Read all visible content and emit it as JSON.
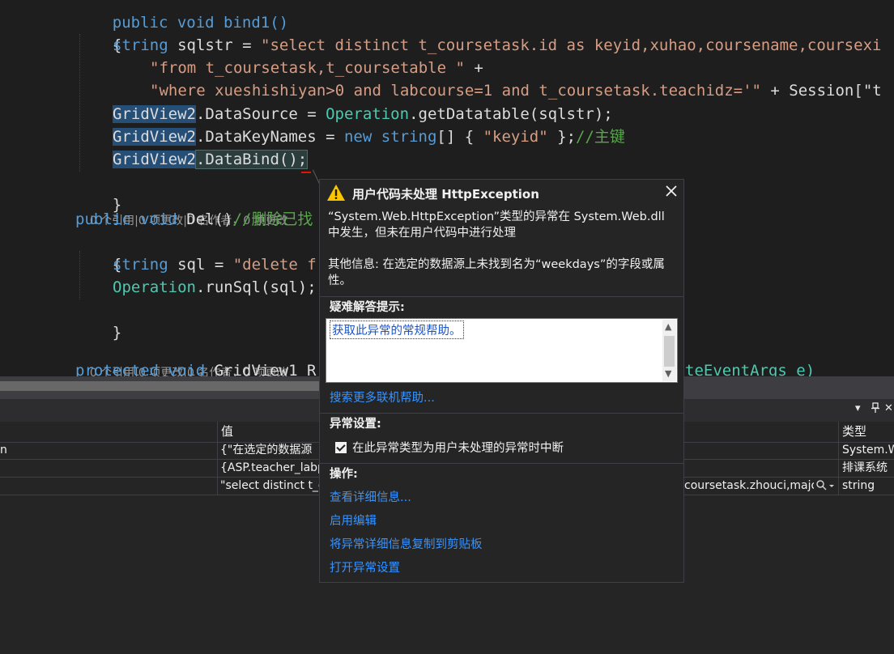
{
  "editor": {
    "line_top": "public void bind1()",
    "brace_open": "{",
    "sql_decl_kw": "string",
    "sql_decl_rest": " sqlstr = ",
    "sql_line1_str": "\"select distinct t_coursetask.id as keyid,xuhao,coursename,coursexi",
    "sql_line2_str": "\"from t_coursetask,t_coursetable \"",
    "sql_line2_op": " +",
    "sql_line3_str": "\"where xueshishiyan>0 and labcourse=1 and t_coursetask.teachidz='\"",
    "sql_line3_rest": " + Session[\"t",
    "gv2": "GridView2",
    "ds_mid": ".DataSource = ",
    "ds_cls": "Operation",
    "ds_call": ".getDatatable(sqlstr);",
    "dk_mid": ".DataKeyNames = ",
    "dk_new": "new",
    "dk_sp": " ",
    "dk_string": "string",
    "dk_arr": "[] { ",
    "dk_str": "\"keyid\"",
    "dk_end": " };",
    "dk_cmt": "//主键",
    "db_call": ".DataBind();",
    "brace_close": "}",
    "lens1": "0 个引用|0 项更改|0 名作者，0 项更改",
    "del_kw": "public void",
    "del_name": " Del()",
    "del_cmt": "//删除已找",
    "brace2_open": "{",
    "del_sql_kw": "string",
    "del_sql_rest": " sql = ",
    "del_sql_str": "\"delete f",
    "run_cls": "Operation",
    "run_call": ".runSql(sql);",
    "brace2_close": "}",
    "lens2": "0 个引用|0 项更改|0 名作者，0 项更改",
    "last_kw": "protected void",
    "last_name": " GridView1_R",
    "last_tail": "teEventArgs e)"
  },
  "popup": {
    "title": "用户代码未处理 HttpException",
    "message": "“System.Web.HttpException”类型的异常在 System.Web.dll 中发生，但未在用户代码中进行处理",
    "other_info": "其他信息: 在选定的数据源上未找到名为“weekdays”的字段或属性。",
    "tips_header": "疑难解答提示:",
    "help_link": "获取此异常的常规帮助。",
    "search_more": "搜索更多联机帮助...",
    "settings_header": "异常设置:",
    "break_checkbox_label": "在此异常类型为用户未处理的异常时中断",
    "break_checked": true,
    "actions_header": "操作:",
    "actions": [
      "查看详细信息...",
      "启用编辑",
      "将异常详细信息复制到剪贴板",
      "打开异常设置"
    ]
  },
  "autos": {
    "columns": [
      "值",
      "类型"
    ],
    "rows": [
      {
        "name": "n",
        "value": "{\"在选定的数据源",
        "type": "System.W"
      },
      {
        "name": "",
        "value": "{ASP.teacher_labpa",
        "type": "排课系统"
      },
      {
        "name": "",
        "value": "\"select distinct t_co",
        "value_tail": "coursetask.zhouci,major,",
        "type": "string"
      }
    ],
    "pane_controls": [
      "▾",
      "🖈",
      "✕"
    ]
  }
}
